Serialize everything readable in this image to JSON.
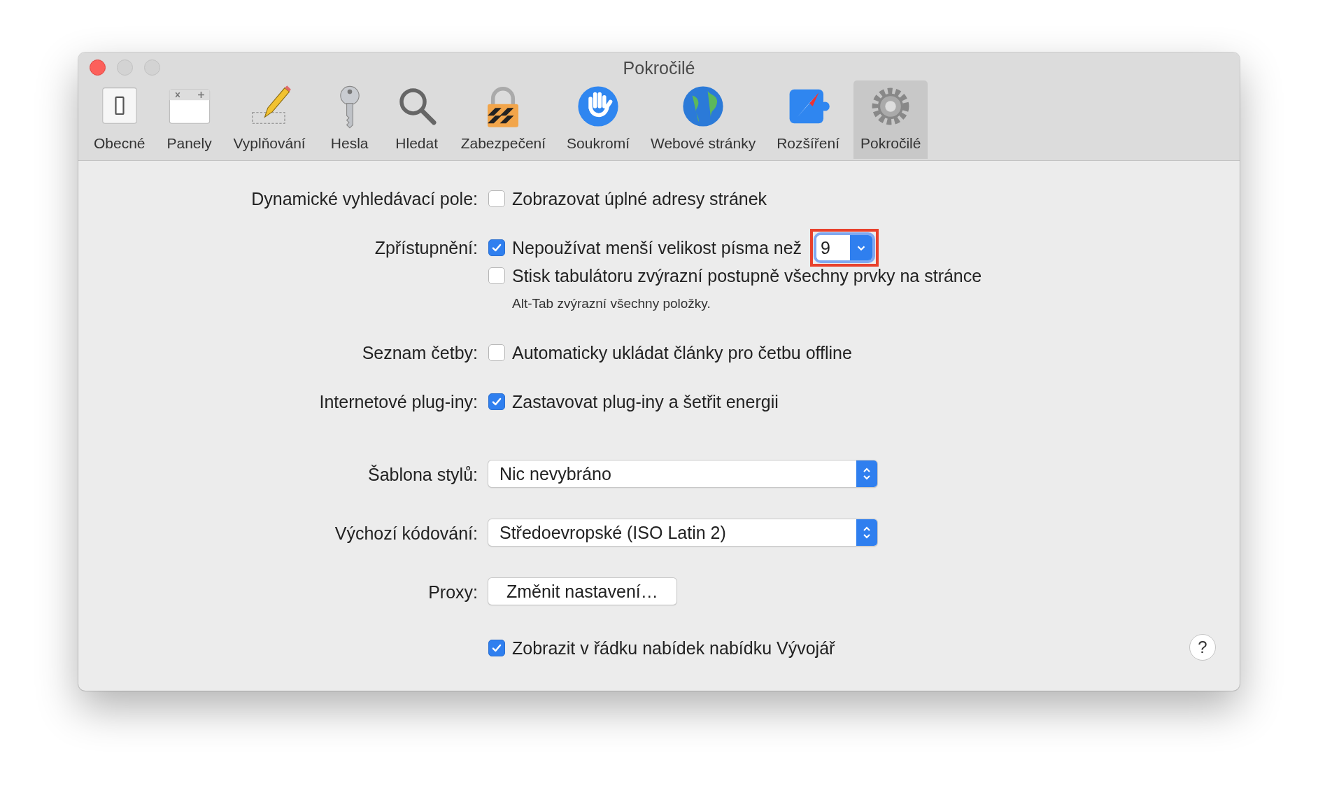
{
  "window": {
    "title": "Pokročilé"
  },
  "toolbar": [
    {
      "label": "Obecné",
      "selected": false
    },
    {
      "label": "Panely",
      "selected": false
    },
    {
      "label": "Vyplňování",
      "selected": false
    },
    {
      "label": "Hesla",
      "selected": false
    },
    {
      "label": "Hledat",
      "selected": false
    },
    {
      "label": "Zabezpečení",
      "selected": false
    },
    {
      "label": "Soukromí",
      "selected": false
    },
    {
      "label": "Webové stránky",
      "selected": false
    },
    {
      "label": "Rozšíření",
      "selected": false
    },
    {
      "label": "Pokročilé",
      "selected": true
    }
  ],
  "sections": [
    {
      "kind": "checks",
      "label": "Dynamické vyhledávací pole:",
      "items": [
        {
          "kind": "checkbox",
          "text": "Zobrazovat úplné adresy stránek",
          "checked": false
        }
      ]
    },
    {
      "kind": "checks",
      "label": "Zpřístupnění:",
      "items": [
        {
          "kind": "checkbox",
          "text": "Nepoužívat menší velikost písma než",
          "checked": true,
          "combo": {
            "value": "9",
            "highlighted": true
          }
        },
        {
          "kind": "checkbox",
          "text": "Stisk tabulátoru zvýrazní postupně všechny prvky na stránce",
          "checked": false
        },
        {
          "kind": "hint",
          "text": "Alt-Tab zvýrazní všechny položky."
        }
      ]
    },
    {
      "kind": "checks",
      "label": "Seznam četby:",
      "items": [
        {
          "kind": "checkbox",
          "text": "Automaticky ukládat články pro četbu offline",
          "checked": false
        }
      ]
    },
    {
      "kind": "checks",
      "label": "Internetové plug-iny:",
      "items": [
        {
          "kind": "checkbox",
          "text": "Zastavovat plug-iny a šetřit energii",
          "checked": true
        }
      ]
    },
    {
      "kind": "popup",
      "label": "Šablona stylů:",
      "items": [
        {
          "kind": "popup",
          "text": "Nic nevybráno"
        }
      ]
    },
    {
      "kind": "popup",
      "label": "Výchozí kódování:",
      "items": [
        {
          "kind": "popup",
          "text": "Středoevropské (ISO Latin 2)"
        }
      ]
    },
    {
      "kind": "popup",
      "label": "Proxy:",
      "items": [
        {
          "kind": "button",
          "text": "Změnit nastavení…"
        }
      ]
    },
    {
      "kind": "checks",
      "items": [
        {
          "kind": "checkbox",
          "text": "Zobrazit v řádku nabídek nabídku Vývojář",
          "checked": true
        }
      ]
    }
  ],
  "help_button": "?"
}
